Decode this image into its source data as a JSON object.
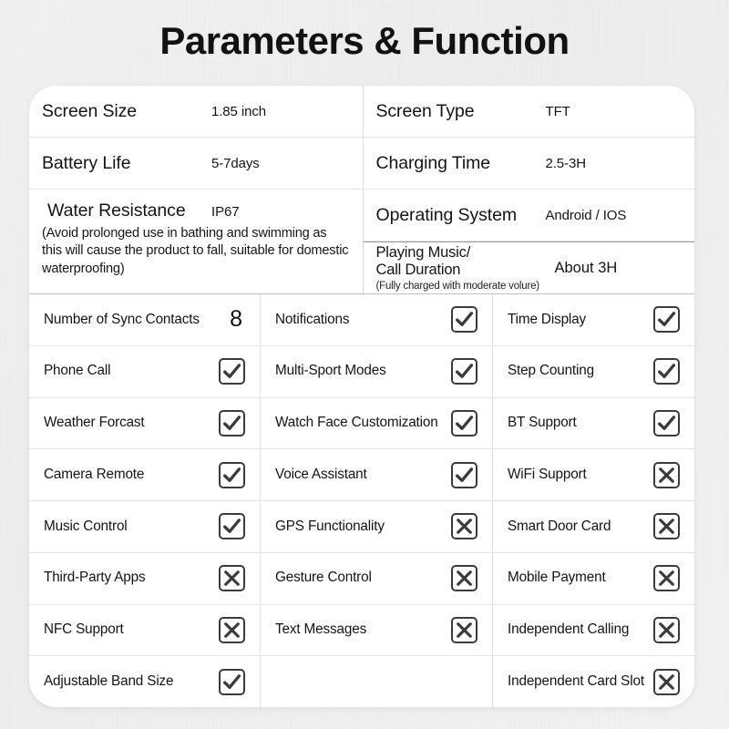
{
  "title": "Parameters & Function",
  "specs": {
    "left": [
      {
        "label": "Screen Size",
        "value": "1.85 inch"
      },
      {
        "label": "Battery Life",
        "value": "5-7days"
      },
      {
        "label": "Water Resistance",
        "value": "IP67",
        "note": "(Avoid prolonged use in bathing and swimming as this will cause the product to fall, suitable for domestic waterproofing)"
      }
    ],
    "right": [
      {
        "label": "Screen Type",
        "value": "TFT"
      },
      {
        "label": "Charging Time",
        "value": "2.5-3H"
      },
      {
        "label": "Operating System",
        "value": "Android / IOS"
      },
      {
        "label_line1": "Playing Music/",
        "label_line2": "Call Duration",
        "note": "(Fully charged with moderate volure)",
        "value": "About 3H"
      }
    ]
  },
  "features": [
    [
      {
        "label": "Number of Sync Contacts",
        "mark": "number",
        "value": "8"
      },
      {
        "label": "Notifications",
        "mark": "check"
      },
      {
        "label": "Time Display",
        "mark": "check"
      }
    ],
    [
      {
        "label": "Phone Call",
        "mark": "check"
      },
      {
        "label": "Multi-Sport Modes",
        "mark": "check"
      },
      {
        "label": "Step Counting",
        "mark": "check"
      }
    ],
    [
      {
        "label": "Weather Forcast",
        "mark": "check"
      },
      {
        "label": "Watch Face Customization",
        "mark": "check"
      },
      {
        "label": "BT Support",
        "mark": "check"
      }
    ],
    [
      {
        "label": "Camera Remote",
        "mark": "check"
      },
      {
        "label": "Voice Assistant",
        "mark": "check"
      },
      {
        "label": "WiFi Support",
        "mark": "cross"
      }
    ],
    [
      {
        "label": "Music Control",
        "mark": "check"
      },
      {
        "label": "GPS Functionality",
        "mark": "cross"
      },
      {
        "label": "Smart Door Card",
        "mark": "cross"
      }
    ],
    [
      {
        "label": "Third-Party Apps",
        "mark": "cross"
      },
      {
        "label": "Gesture Control",
        "mark": "cross"
      },
      {
        "label": "Mobile Payment",
        "mark": "cross"
      }
    ],
    [
      {
        "label": "NFC Support",
        "mark": "cross"
      },
      {
        "label": "Text Messages",
        "mark": "cross"
      },
      {
        "label": "Independent Calling",
        "mark": "cross"
      }
    ],
    [
      {
        "label": "Adjustable Band Size",
        "mark": "check"
      },
      {
        "label": "",
        "mark": "none"
      },
      {
        "label": "Independent Card Slot",
        "mark": "cross"
      }
    ]
  ],
  "colors": {
    "background": "#f1f1f2",
    "card": "#ffffff",
    "text": "#141414",
    "divider": "#e4e4e4",
    "mark": "#3b3b3b"
  }
}
